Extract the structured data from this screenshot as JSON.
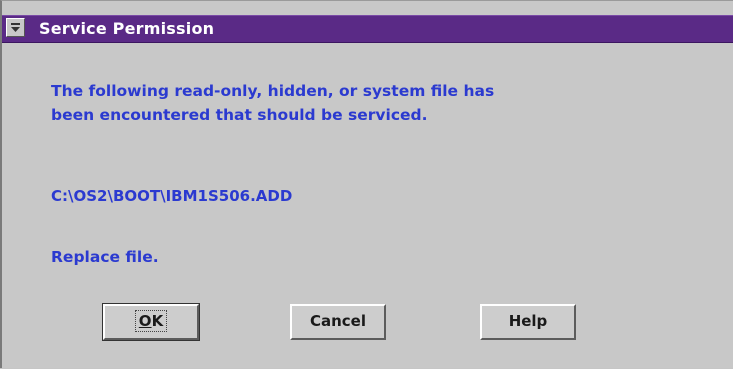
{
  "window": {
    "title": "Service Permission",
    "system_menu_icon": "system-menu-icon"
  },
  "message": {
    "line1": "The following read-only, hidden, or system file has",
    "line2": "been encountered that should be serviced.",
    "file_path": "C:\\OS2\\BOOT\\IBM1S506.ADD",
    "action": "Replace file."
  },
  "buttons": {
    "ok_mnemonic": "O",
    "ok_rest": "K",
    "cancel": "Cancel",
    "help": "Help"
  },
  "colors": {
    "titlebar": "#5a2a86",
    "title_text": "#ffffff",
    "message_text": "#2b3ad0",
    "background": "#c8c8c8"
  }
}
